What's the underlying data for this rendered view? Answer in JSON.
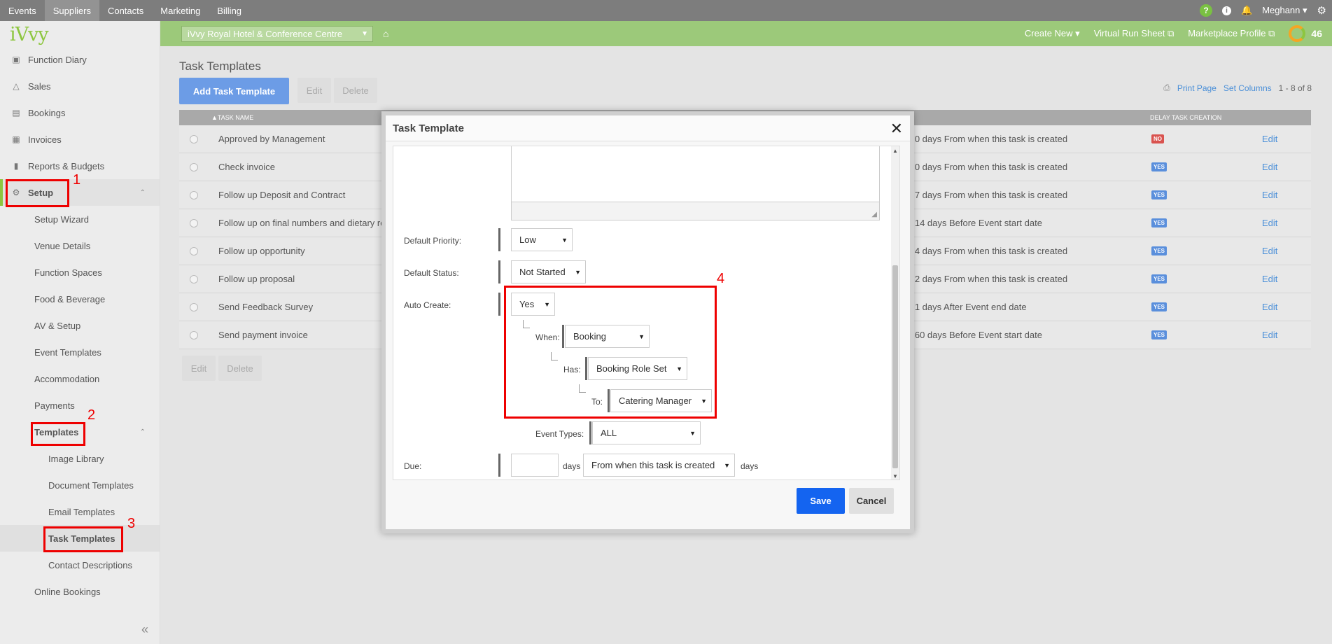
{
  "topnav": {
    "items": [
      "Events",
      "Suppliers",
      "Contacts",
      "Marketing",
      "Billing"
    ],
    "active": "Suppliers"
  },
  "topright": {
    "help": "?",
    "info": "i",
    "user": "Meghann ▾"
  },
  "logo": "iVvy",
  "greenbar": {
    "venue": "iVvy Royal Hotel & Conference Centre",
    "create_new": "Create New ▾",
    "run_sheet": "Virtual Run Sheet ⧉",
    "marketplace": "Marketplace Profile ⧉",
    "score": "46"
  },
  "sidebar": {
    "items": [
      {
        "label": "Function Diary",
        "icon": "📅"
      },
      {
        "label": "Sales",
        "icon": "⚇"
      },
      {
        "label": "Bookings",
        "icon": "▭"
      },
      {
        "label": "Invoices",
        "icon": "▦"
      },
      {
        "label": "Reports & Budgets",
        "icon": "▮"
      },
      {
        "label": "Setup",
        "icon": "⚙"
      }
    ],
    "setup_children": [
      "Setup Wizard",
      "Venue Details",
      "Function Spaces",
      "Food & Beverage",
      "AV & Setup",
      "Event Templates",
      "Accommodation",
      "Payments",
      "Templates"
    ],
    "template_children": [
      "Image Library",
      "Document Templates",
      "Email Templates",
      "Task Templates",
      "Contact Descriptions"
    ],
    "after": [
      "Online Bookings"
    ],
    "collapse": "«"
  },
  "main": {
    "title": "Task Templates",
    "add_button": "Add Task Template",
    "edit": "Edit",
    "delete": "Delete",
    "print": "Print Page",
    "set_columns": "Set Columns",
    "count": "1 - 8 of 8",
    "col_name": "▲TASK NAME",
    "col_delay": "DELAY TASK CREATION",
    "rows": [
      {
        "name": "Approved by Management",
        "due": "n 0 days From when this task is created",
        "delay": "NO",
        "edit": "Edit"
      },
      {
        "name": "Check invoice",
        "due": "n 0 days From when this task is created",
        "delay": "YES",
        "edit": "Edit"
      },
      {
        "name": "Follow up Deposit and Contract",
        "due": "n 7 days From when this task is created",
        "delay": "YES",
        "edit": "Edit"
      },
      {
        "name": "Follow up on final numbers and dietary re",
        "due": "n 14 days Before Event start date",
        "delay": "YES",
        "edit": "Edit"
      },
      {
        "name": "Follow up opportunity",
        "due": "n 4 days From when this task is created",
        "delay": "YES",
        "edit": "Edit"
      },
      {
        "name": "Follow up proposal",
        "due": "n 2 days From when this task is created",
        "delay": "YES",
        "edit": "Edit"
      },
      {
        "name": "Send Feedback Survey",
        "due": "n 1 days After Event end date",
        "delay": "YES",
        "edit": "Edit"
      },
      {
        "name": "Send payment invoice",
        "due": "n 60 days Before Event start date",
        "delay": "YES",
        "edit": "Edit"
      }
    ],
    "bottom_edit": "Edit",
    "bottom_delete": "Delete"
  },
  "modal": {
    "title": "Task Template",
    "close": "✕",
    "default_priority_label": "Default Priority:",
    "default_priority": "Low",
    "default_status_label": "Default Status:",
    "default_status": "Not Started",
    "auto_create_label": "Auto Create:",
    "auto_create": "Yes",
    "when_label": "When:",
    "when": "Booking",
    "has_label": "Has:",
    "has": "Booking Role Set",
    "to_label": "To:",
    "to": "Catering Manager",
    "event_types_label": "Event Types:",
    "event_types": "ALL",
    "due_label": "Due:",
    "due_days_text": "days",
    "due_from": "From when this task is created",
    "due_days_text2": "days",
    "save": "Save",
    "cancel": "Cancel"
  },
  "annotations": [
    "1",
    "2",
    "3",
    "4"
  ],
  "colors": {
    "green": "#9cc97a",
    "accent": "#1464f0",
    "annotation": "#ee0000"
  }
}
